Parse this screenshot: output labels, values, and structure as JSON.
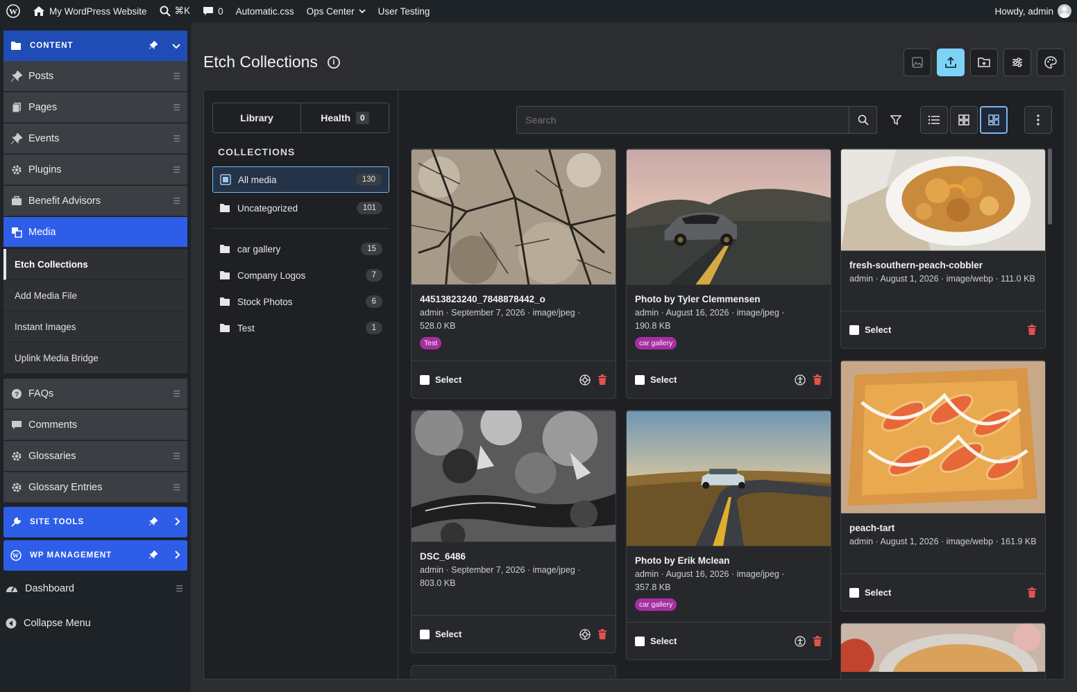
{
  "adminbar": {
    "site_name": "My WordPress Website",
    "shortcut": "⌘K",
    "comments_count": "0",
    "automatic_css": "Automatic.css",
    "ops_center": "Ops Center",
    "user_testing": "User Testing",
    "howdy": "Howdy, admin"
  },
  "sidebar": {
    "content_group": "CONTENT",
    "items": [
      {
        "label": "Posts"
      },
      {
        "label": "Pages"
      },
      {
        "label": "Events"
      },
      {
        "label": "Plugins"
      },
      {
        "label": "Benefit Advisors"
      },
      {
        "label": "Media"
      }
    ],
    "submenu": [
      "Etch Collections",
      "Add Media File",
      "Instant Images",
      "Uplink Media Bridge"
    ],
    "items2": [
      {
        "label": "FAQs"
      },
      {
        "label": "Comments"
      },
      {
        "label": "Glossaries"
      },
      {
        "label": "Glossary Entries"
      }
    ],
    "site_tools": "SITE TOOLS",
    "wp_management": "WP MANAGEMENT",
    "dashboard": "Dashboard",
    "collapse": "Collapse Menu"
  },
  "page": {
    "title": "Etch Collections"
  },
  "tabs": {
    "library": "Library",
    "health": "Health",
    "health_count": "0"
  },
  "collections": {
    "heading": "COLLECTIONS",
    "items": [
      {
        "label": "All media",
        "count": "130"
      },
      {
        "label": "Uncategorized",
        "count": "101"
      },
      {
        "label": "car gallery",
        "count": "15"
      },
      {
        "label": "Company Logos",
        "count": "7"
      },
      {
        "label": "Stock Photos",
        "count": "6"
      },
      {
        "label": "Test",
        "count": "1"
      }
    ]
  },
  "search": {
    "placeholder": "Search"
  },
  "cards": [
    {
      "title": "44513823240_7848878442_o",
      "meta1": "admin · September 7, 2026 · image/jpeg ·",
      "meta2": "528.0 KB",
      "tag": "Test",
      "select": "Select"
    },
    {
      "title": "Photo by Tyler Clemmensen",
      "meta1": "admin · August 16, 2026 · image/jpeg ·",
      "meta2": "190.8 KB",
      "tag": "car gallery",
      "select": "Select"
    },
    {
      "title": "fresh-southern-peach-cobbler",
      "meta1": "admin · August 1, 2026 · image/webp · 111.0 KB",
      "select": "Select"
    },
    {
      "title": "DSC_6486",
      "meta1": "admin · September 7, 2026 · image/jpeg ·",
      "meta2": "803.0 KB",
      "select": "Select"
    },
    {
      "title": "Photo by Erik Mclean",
      "meta1": "admin · August 16, 2026 · image/jpeg ·",
      "meta2": "357.8 KB",
      "tag": "car gallery",
      "select": "Select"
    },
    {
      "title": "peach-tart",
      "meta1": "admin · August 1, 2026 · image/webp · 161.9 KB",
      "select": "Select"
    }
  ],
  "colors": {
    "accent": "#2e5de8",
    "group_blue": "#1f4cb5",
    "upload": "#7dd3f5",
    "tag": "#a52fa0",
    "delete": "#e0524f"
  }
}
